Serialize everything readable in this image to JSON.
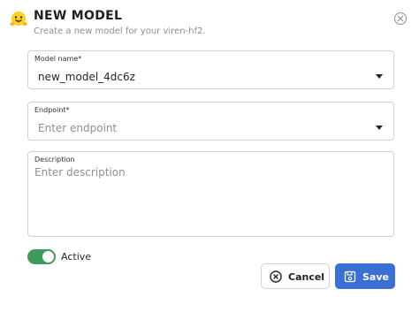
{
  "header": {
    "title": "NEW MODEL",
    "subtitle": "Create a new model for your viren-hf2.",
    "emoji_icon": "hugging-face-emoji",
    "close_icon": "close-icon"
  },
  "form": {
    "model_name": {
      "label": "Model name*",
      "value": "new_model_4dc6z"
    },
    "endpoint": {
      "label": "Endpoint*",
      "placeholder": "Enter endpoint"
    },
    "description": {
      "label": "Description",
      "placeholder": "Enter description"
    },
    "active": {
      "label": "Active",
      "enabled": true
    }
  },
  "buttons": {
    "cancel": "Cancel",
    "save": "Save"
  },
  "colors": {
    "toggle_on": "#3d9b5b",
    "save_button": "#3b6fd6"
  }
}
